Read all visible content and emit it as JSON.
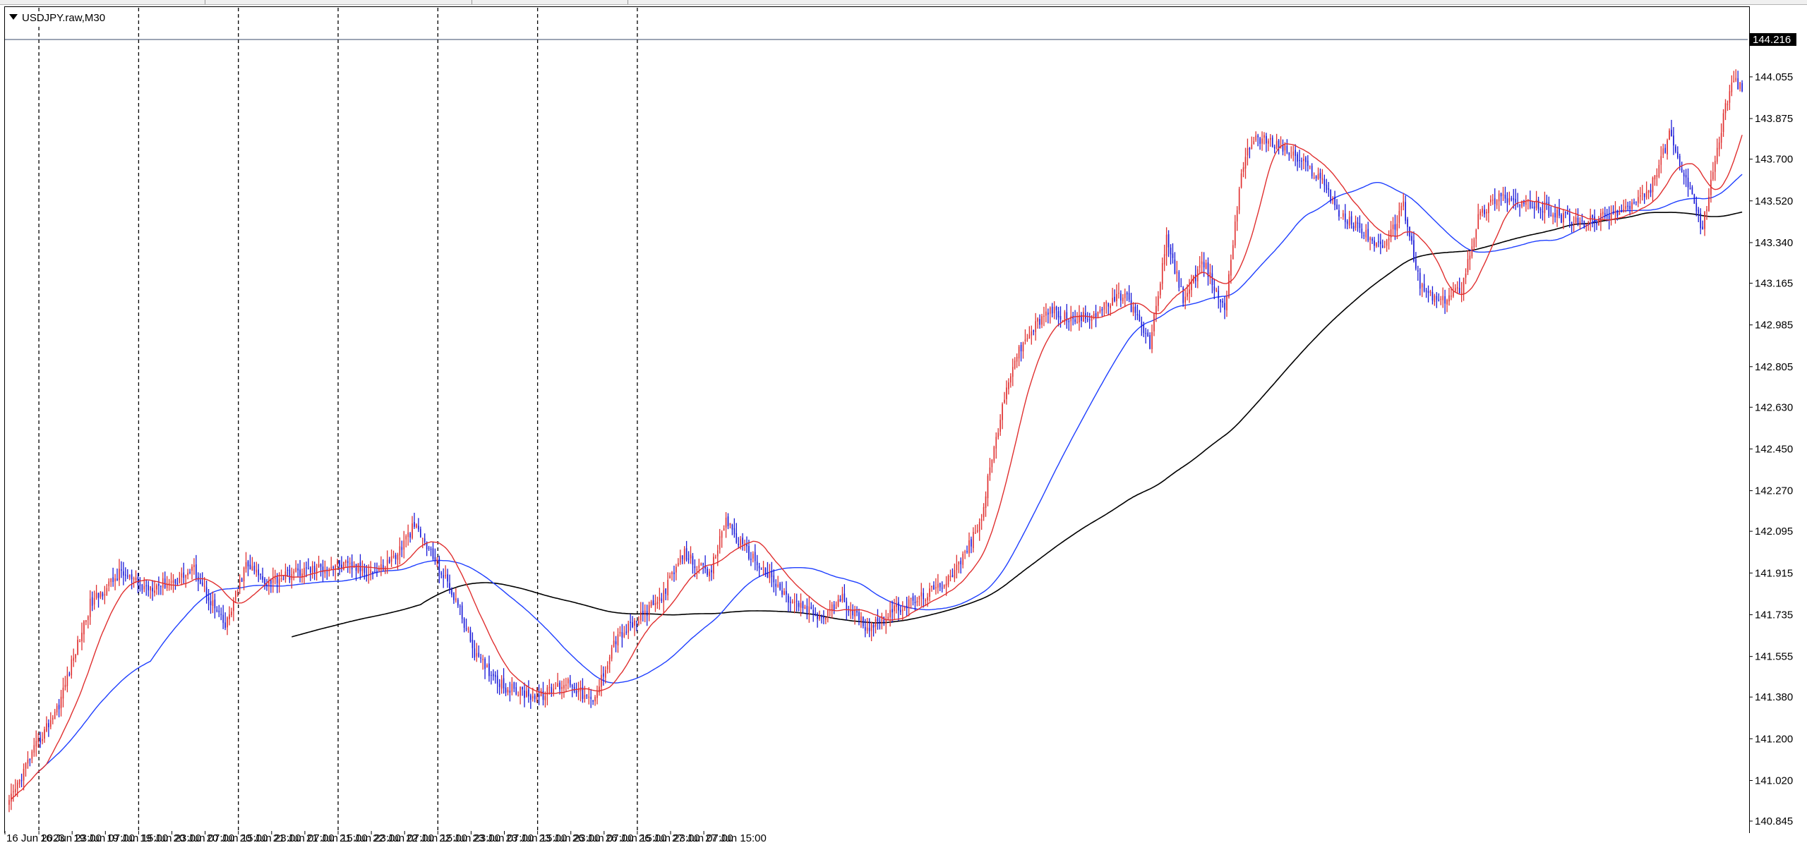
{
  "window": {
    "symbol_label": "USDJPY.raw,M30"
  },
  "price_axis": {
    "ticks": [
      "144.055",
      "143.875",
      "143.700",
      "143.520",
      "143.340",
      "143.165",
      "142.985",
      "142.805",
      "142.630",
      "142.450",
      "142.270",
      "142.095",
      "141.915",
      "141.735",
      "141.555",
      "141.380",
      "141.200",
      "141.020",
      "140.845"
    ],
    "current_price": "144.216"
  },
  "time_axis": {
    "labels": [
      "16 Jun 2023",
      "16 Jun 23:00",
      "19 Jun 07:00",
      "19 Jun 15:00",
      "19 Jun 23:00",
      "20 Jun 07:00",
      "20 Jun 15:00",
      "20 Jun 23:00",
      "21 Jun 07:00",
      "21 Jun 15:00",
      "21 Jun 23:00",
      "22 Jun 07:00",
      "22 Jun 15:00",
      "22 Jun 23:00",
      "23 Jun 07:00",
      "23 Jun 15:00",
      "23 Jun 23:00",
      "26 Jun 07:00",
      "26 Jun 15:00",
      "26 Jun 23:00",
      "27 Jun 07:00",
      "27 Jun 15:00"
    ]
  },
  "colors": {
    "bull_candle": "#e03030",
    "bear_candle": "#1a1ad8",
    "ma_fast": "#e03030",
    "ma_mid": "#1f3fff",
    "ma_slow": "#000000",
    "grid_separator": "#000000",
    "price_tag_bg": "#000000",
    "price_tag_text": "#ffffff"
  },
  "chart_data": {
    "type": "candlestick",
    "symbol": "USDJPY.raw",
    "timeframe": "M30",
    "y_range": [
      140.845,
      144.216
    ],
    "last_price": 144.216,
    "trend_path": [
      [
        0,
        140.9
      ],
      [
        10,
        141.1
      ],
      [
        25,
        141.35
      ],
      [
        40,
        141.78
      ],
      [
        55,
        141.92
      ],
      [
        65,
        141.85
      ],
      [
        80,
        141.88
      ],
      [
        90,
        141.93
      ],
      [
        105,
        141.68
      ],
      [
        115,
        141.95
      ],
      [
        125,
        141.88
      ],
      [
        140,
        141.92
      ],
      [
        160,
        141.95
      ],
      [
        178,
        141.92
      ],
      [
        188,
        142.0
      ],
      [
        196,
        142.12
      ],
      [
        206,
        141.97
      ],
      [
        216,
        141.8
      ],
      [
        226,
        141.55
      ],
      [
        240,
        141.42
      ],
      [
        256,
        141.38
      ],
      [
        270,
        141.45
      ],
      [
        282,
        141.35
      ],
      [
        292,
        141.62
      ],
      [
        302,
        141.7
      ],
      [
        314,
        141.8
      ],
      [
        326,
        142.0
      ],
      [
        338,
        141.9
      ],
      [
        346,
        142.15
      ],
      [
        352,
        142.05
      ],
      [
        362,
        141.95
      ],
      [
        376,
        141.8
      ],
      [
        392,
        141.72
      ],
      [
        402,
        141.8
      ],
      [
        414,
        141.68
      ],
      [
        426,
        141.75
      ],
      [
        438,
        141.8
      ],
      [
        448,
        141.85
      ],
      [
        458,
        141.95
      ],
      [
        468,
        142.12
      ],
      [
        476,
        142.5
      ],
      [
        484,
        142.82
      ],
      [
        492,
        142.95
      ],
      [
        502,
        143.05
      ],
      [
        514,
        143.0
      ],
      [
        526,
        143.05
      ],
      [
        538,
        143.12
      ],
      [
        550,
        142.9
      ],
      [
        558,
        143.35
      ],
      [
        566,
        143.1
      ],
      [
        576,
        143.25
      ],
      [
        586,
        143.05
      ],
      [
        594,
        143.65
      ],
      [
        600,
        143.8
      ],
      [
        614,
        143.75
      ],
      [
        624,
        143.68
      ],
      [
        634,
        143.6
      ],
      [
        642,
        143.45
      ],
      [
        652,
        143.4
      ],
      [
        662,
        143.3
      ],
      [
        672,
        143.5
      ],
      [
        680,
        143.15
      ],
      [
        690,
        143.08
      ],
      [
        700,
        143.15
      ],
      [
        708,
        143.45
      ],
      [
        718,
        143.55
      ],
      [
        728,
        143.5
      ],
      [
        738,
        143.5
      ],
      [
        748,
        143.45
      ],
      [
        758,
        143.42
      ],
      [
        768,
        143.45
      ],
      [
        778,
        143.48
      ],
      [
        790,
        143.55
      ],
      [
        800,
        143.8
      ],
      [
        808,
        143.6
      ],
      [
        816,
        143.4
      ],
      [
        822,
        143.7
      ],
      [
        830,
        144.05
      ],
      [
        836,
        144.0
      ]
    ]
  }
}
